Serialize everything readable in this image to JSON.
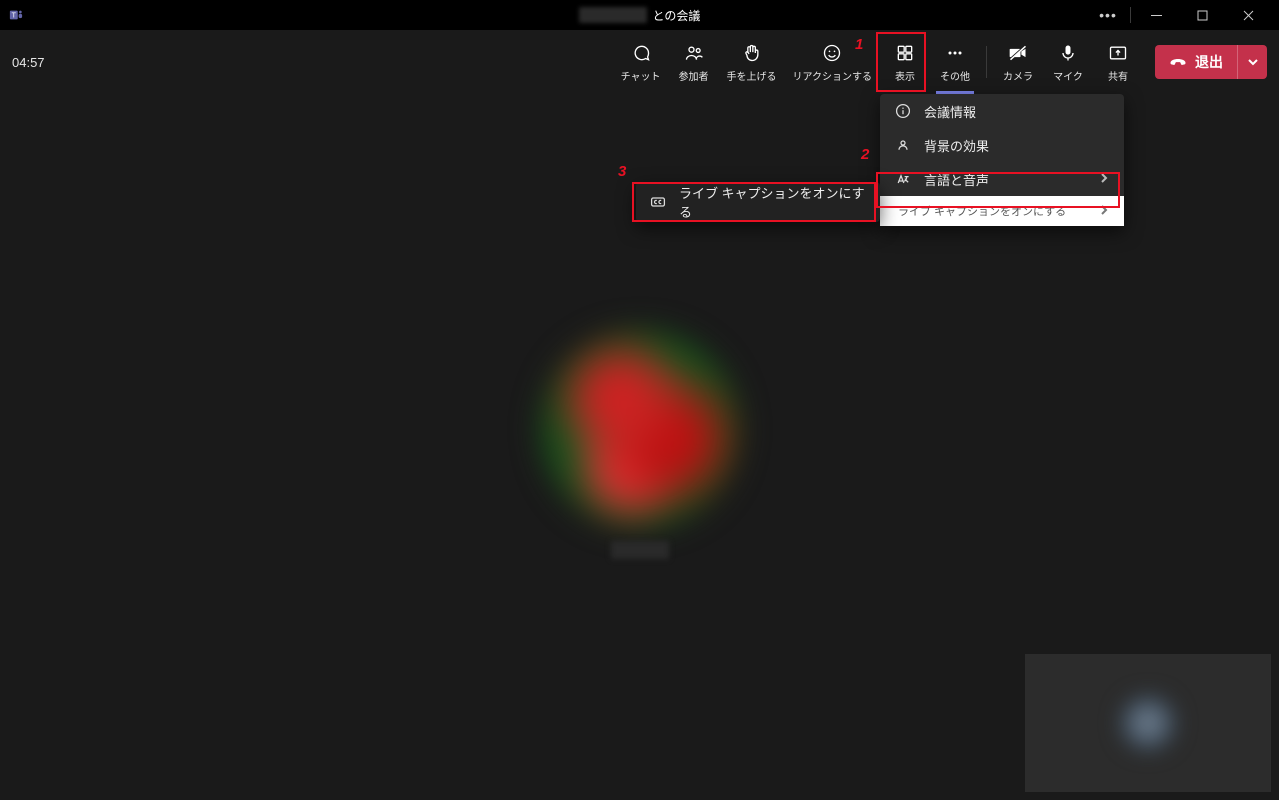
{
  "titlebar": {
    "title_suffix": "との会議"
  },
  "toolbar": {
    "timer": "04:57",
    "chat": "チャット",
    "participants": "参加者",
    "raise_hand": "手を上げる",
    "react": "リアクションする",
    "view": "表示",
    "more": "その他",
    "camera": "カメラ",
    "mic": "マイク",
    "share": "共有",
    "leave": "退出"
  },
  "menu": {
    "meeting_info": "会議情報",
    "background_effects": "背景の効果",
    "language_speech": "言語と音声",
    "live_caption_desc": "ライブ キャプションをオンにする"
  },
  "submenu": {
    "turn_on_live_caption": "ライブ キャプションをオンにする"
  },
  "steps": {
    "s1": "1",
    "s2": "2",
    "s3": "3"
  }
}
